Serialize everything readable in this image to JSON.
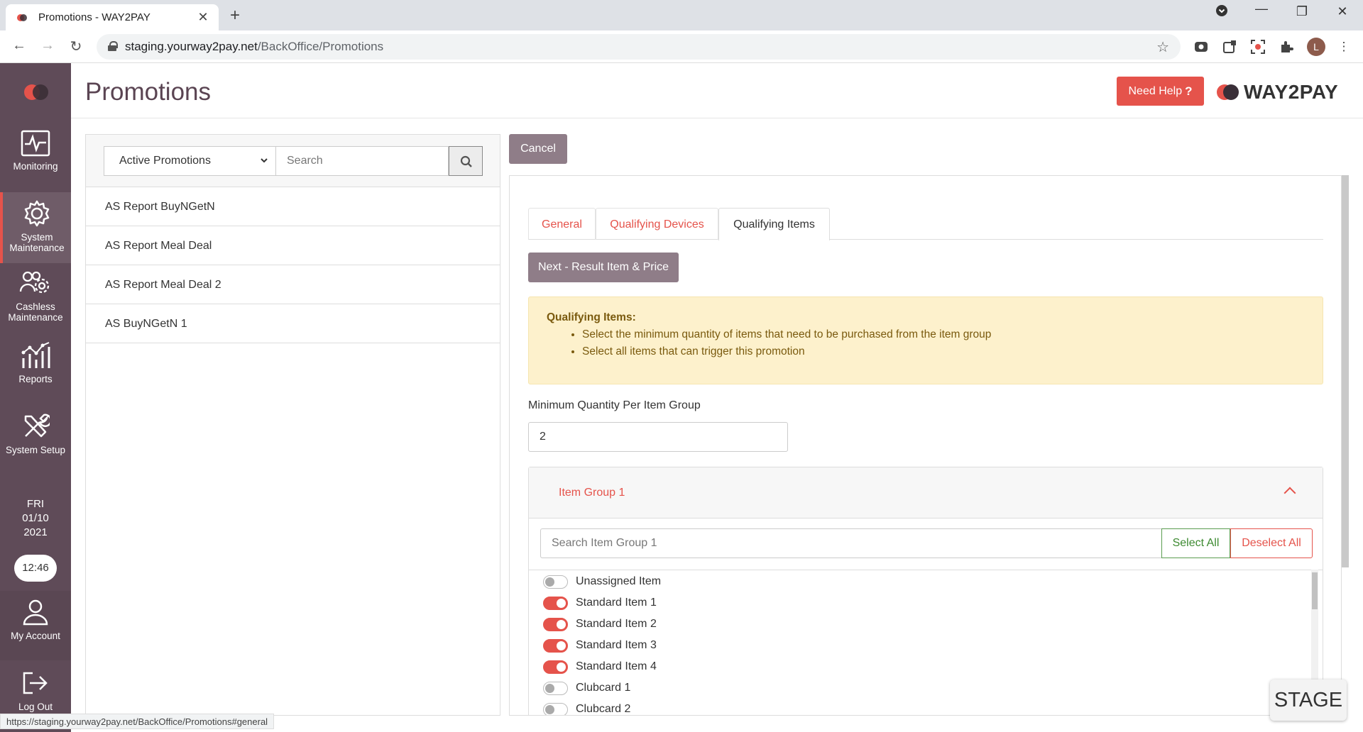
{
  "browser": {
    "tab_title": "Promotions - WAY2PAY",
    "url_host": "staging.yourway2pay.net",
    "url_path": "/BackOffice/Promotions",
    "profile_initial": "L",
    "status_url": "https://staging.yourway2pay.net/BackOffice/Promotions#general"
  },
  "sidebar": {
    "items": [
      {
        "label_1": "Monitoring",
        "label_2": ""
      },
      {
        "label_1": "System",
        "label_2": "Maintenance"
      },
      {
        "label_1": "Cashless",
        "label_2": "Maintenance"
      },
      {
        "label_1": "Reports",
        "label_2": ""
      },
      {
        "label_1": "System Setup",
        "label_2": ""
      },
      {
        "label_1": "My Account",
        "label_2": ""
      },
      {
        "label_1": "Log Out",
        "label_2": ""
      }
    ],
    "active_item": "System Maintenance",
    "day": "FRI",
    "date": "01/10",
    "year": "2021",
    "time": "12:46"
  },
  "header": {
    "title": "Promotions",
    "help_label": "Need Help",
    "help_mark": "?",
    "brand": "WAY2PAY"
  },
  "left_panel": {
    "filter_selected": "Active Promotions",
    "search_placeholder": "Search",
    "promotions": [
      "AS Report BuyNGetN",
      "AS Report Meal Deal",
      "AS Report Meal Deal 2",
      "AS BuyNGetN 1"
    ]
  },
  "editor": {
    "cancel_label": "Cancel",
    "tabs": [
      "General",
      "Qualifying Devices",
      "Qualifying Items"
    ],
    "active_tab": "Qualifying Items",
    "next_label": "Next - Result Item & Price",
    "info_title": "Qualifying Items:",
    "info_points": [
      "Select the minimum quantity of items that need to be purchased from the item group",
      "Select all items that can trigger this promotion"
    ],
    "min_qty_label": "Minimum Quantity Per Item Group",
    "min_qty_value": "2",
    "group": {
      "title": "Item Group 1",
      "search_placeholder": "Search Item Group 1",
      "select_all_label": "Select All",
      "deselect_all_label": "Deselect All",
      "items": [
        {
          "label": "Unassigned Item",
          "on": false
        },
        {
          "label": "Standard Item 1",
          "on": true
        },
        {
          "label": "Standard Item 2",
          "on": true
        },
        {
          "label": "Standard Item 3",
          "on": true
        },
        {
          "label": "Standard Item 4",
          "on": true
        },
        {
          "label": "Clubcard 1",
          "on": false
        },
        {
          "label": "Clubcard 2",
          "on": false
        }
      ]
    }
  },
  "badge": "STAGE",
  "colors": {
    "accent": "#e5534b",
    "sidebar": "#5f4b58",
    "muted_button": "#8f7d88",
    "info_bg": "#fdf1cc"
  }
}
